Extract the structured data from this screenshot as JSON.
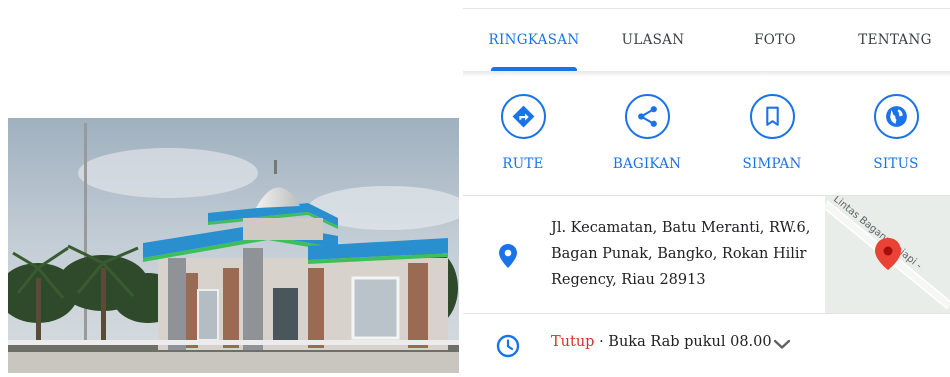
{
  "tabs": [
    {
      "label": "RINGKASAN",
      "active": true
    },
    {
      "label": "ULASAN",
      "active": false
    },
    {
      "label": "FOTO",
      "active": false
    },
    {
      "label": "TENTANG",
      "active": false
    }
  ],
  "actions": [
    {
      "label": "RUTE",
      "icon": "directions-icon"
    },
    {
      "label": "BAGIKAN",
      "icon": "share-icon"
    },
    {
      "label": "SIMPAN",
      "icon": "bookmark-icon"
    },
    {
      "label": "SITUS",
      "icon": "globe-icon"
    }
  ],
  "address": {
    "line1": "Jl. Kecamatan, Batu Meranti, RW.6,",
    "line2": "Bagan Punak, Bangko, Rokan Hilir",
    "line3": "Regency, Riau 28913"
  },
  "map": {
    "road_label": "Lintas Bagansiapiapi -"
  },
  "hours": {
    "status": "Tutup",
    "separator": " · ",
    "next_open": "Buka Rab pukul 08.00"
  },
  "colors": {
    "accent": "#1a73e8",
    "closed": "#d93025",
    "pin": "#ea4335"
  }
}
